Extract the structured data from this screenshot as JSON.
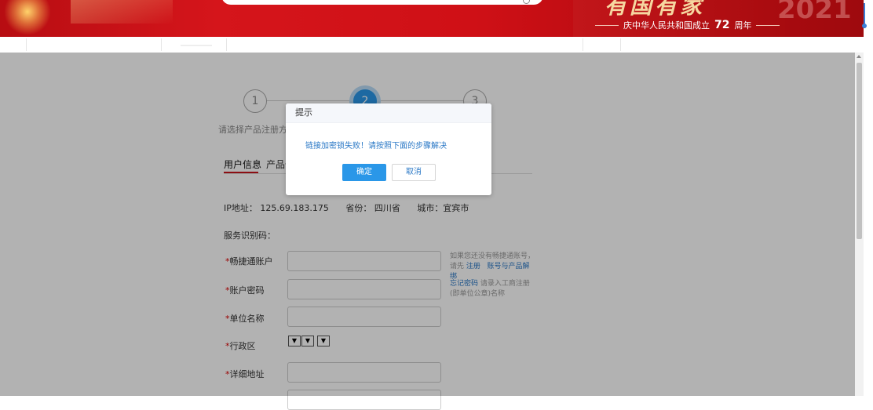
{
  "banner": {
    "slogan_prefix": "庆中华人民共和国成立",
    "slogan_num": "72",
    "slogan_suffix": "周年",
    "year": "2021"
  },
  "steps": [
    {
      "num": "1",
      "label": "请选择产品注册方式"
    },
    {
      "num": "2",
      "label": ""
    },
    {
      "num": "3",
      "label": ""
    }
  ],
  "tabs": [
    "用户信息",
    "产品信"
  ],
  "info": {
    "ip_label": "IP地址：",
    "ip": "125.69.183.175",
    "province_label": "省份：",
    "province": "四川省",
    "city_label": "城市：",
    "city": "宜宾市"
  },
  "service_code_label": "服务识别码：",
  "form": {
    "account_label": "畅捷通账户",
    "password_label": "账户密码",
    "company_label": "单位名称",
    "region_label": "行政区",
    "address_label": "详细地址",
    "required_mark": "*"
  },
  "hints": {
    "account_text": "如果您还没有畅捷通账号，请先",
    "register_link": "注册",
    "unbind_link": "账号与产品解绑",
    "forgot_link": "忘记密码",
    "forgot_text": "请录入工商注册(即单位公章)名称"
  },
  "select_arrow": "▼",
  "dialog": {
    "title": "提示",
    "message": "链接加密锁失败！请按照下面的步骤解决",
    "ok": "确定",
    "cancel": "取消"
  },
  "colors": {
    "primary": "#2a97e8",
    "banner_red": "#cf1016",
    "tab_underline": "#c9151c"
  }
}
